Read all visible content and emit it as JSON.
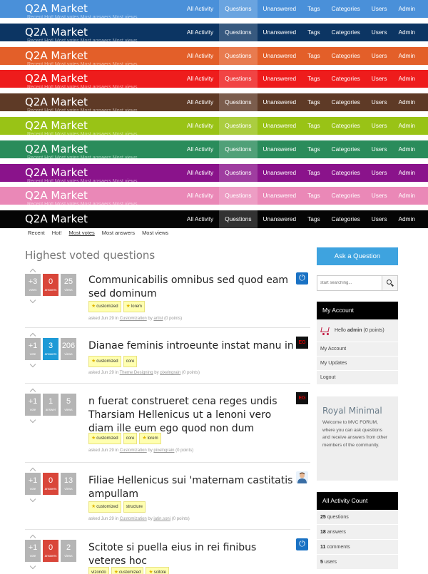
{
  "site": {
    "logo": "Q2A Market"
  },
  "nav": [
    "All Activity",
    "Questions",
    "Unanswered",
    "Tags",
    "Categories",
    "Users",
    "Admin"
  ],
  "themes": [
    {
      "color": "#4a90d9",
      "active_label": "Questions"
    },
    {
      "color": "#0c3563",
      "active_label": "Questions"
    },
    {
      "color": "#e35f29",
      "active_label": "Questions"
    },
    {
      "color": "#ee1c1c",
      "active_label": "Questions"
    },
    {
      "color": "#5e3a26",
      "active_label": "Questions"
    },
    {
      "color": "#99c316",
      "active_label": "Questions"
    },
    {
      "color": "#2a8c5b",
      "active_label": "Questions"
    },
    {
      "color": "#8a138b",
      "active_label": "Questions"
    },
    {
      "color": "#ea88b7",
      "active_label": "Questions"
    },
    {
      "color": "#050505",
      "active_label": "Questions"
    }
  ],
  "ghost_text": "Recent   Hot!   Most votes   Most answers   Most views",
  "subnav": [
    "Recent",
    "Hot!",
    "Most votes",
    "Most answers",
    "Most views"
  ],
  "subnav_active": "Most votes",
  "page_title": "Highest voted questions",
  "questions": [
    {
      "votes": "+3",
      "votes_label": "votes",
      "answers": "0",
      "answers_label": "answers",
      "answers_style": "red",
      "views": "25",
      "views_label": "views",
      "title": "Communicabilis omnibus sed quod eam sed dominum",
      "tags": [
        "customized",
        "lorem"
      ],
      "meta_pre": "asked Jun 29 in",
      "category": "Customization",
      "meta_by": "by",
      "user": "artist",
      "points": "(0 points)",
      "avatar": "power-icon"
    },
    {
      "votes": "+1",
      "votes_label": "vote",
      "answers": "3",
      "answers_label": "answers",
      "answers_style": "blue",
      "views": "206",
      "views_label": "views",
      "title": "Dianae feminis introeunte instat manu in",
      "tags": [
        "customized",
        "core"
      ],
      "meta_pre": "asked Jun 29 in",
      "category": "Theme Designing",
      "meta_by": "by",
      "user": "pixelngrain",
      "points": "(0 points)",
      "avatar": "eg-icon"
    },
    {
      "votes": "+1",
      "votes_label": "vote",
      "answers": "1",
      "answers_label": "answer",
      "answers_style": "grey",
      "views": "5",
      "views_label": "views",
      "title": "n fuerat construeret cena reges undis Tharsiam Hellenicus ut a lenoni vero diam ille eum ego quod non dum",
      "tags": [
        "customized",
        "core",
        "lorem"
      ],
      "meta_pre": "asked Jun 29 in",
      "category": "Customization",
      "meta_by": "by",
      "user": "pixelngrain",
      "points": "(0 points)",
      "avatar": "eg-icon"
    },
    {
      "votes": "+1",
      "votes_label": "vote",
      "answers": "0",
      "answers_label": "answers",
      "answers_style": "red",
      "views": "13",
      "views_label": "views",
      "title": "Filiae Hellenicus sui 'maternam castitatis ampullam",
      "tags": [
        "customized",
        "structure"
      ],
      "meta_pre": "asked Jun 29 in",
      "category": "Customization",
      "meta_by": "by",
      "user": "jatin.soni",
      "points": "(0 points)",
      "avatar": "person-icon"
    },
    {
      "votes": "+1",
      "votes_label": "vote",
      "answers": "0",
      "answers_label": "answers",
      "answers_style": "red",
      "views": "2",
      "views_label": "views",
      "title": "Scitote si puella eius in rei finibus veteres hoc",
      "tags": [
        "vizondo",
        "customized",
        "scitote"
      ],
      "meta_pre": "asked Jun 29 in",
      "category": "Plugin Development",
      "meta_by": "by",
      "user": "artist",
      "points": "(0 points)",
      "avatar": "power-icon"
    }
  ],
  "sidebar": {
    "ask_button": "Ask a Question",
    "search_placeholder": "start searching...",
    "account_title": "My Account",
    "hello_pre": "Hello",
    "hello_user": "admin",
    "hello_points": "(0 points)",
    "account_links": [
      "My Account",
      "My Updates",
      "Logout"
    ],
    "royal_title": "Royal Minimal",
    "royal_text": "Welcome to MVC FORUM, where you can ask questions and receive answers from other members of the community.",
    "count_title": "All Activity Count",
    "counts": [
      {
        "value": "25",
        "label": "questions"
      },
      {
        "value": "18",
        "label": "answers"
      },
      {
        "value": "11",
        "label": "comments"
      },
      {
        "value": "5",
        "label": "users"
      }
    ]
  }
}
